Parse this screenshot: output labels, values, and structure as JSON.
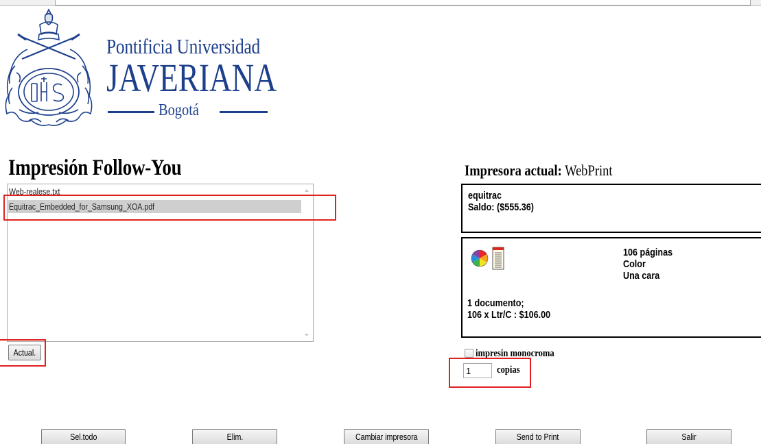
{
  "logo": {
    "line1": "Pontificia Universidad",
    "line2": "JAVERIANA",
    "city": "Bogotá",
    "color": "#1d3f8c"
  },
  "page_title": "Impresión Follow-You",
  "files": [
    {
      "name": "Web-realese.txt",
      "selected": false
    },
    {
      "name": "Equitrac_Embedded_for_Samsung_XOA.pdf",
      "selected": true
    }
  ],
  "actual_button": "Actual.",
  "printer": {
    "label": "Impresora actual:",
    "name": "WebPrint"
  },
  "account": {
    "user": "equitrac",
    "balance": "Saldo: ($555.36)"
  },
  "job": {
    "icons": [
      "color-wheel-icon",
      "document-icon"
    ],
    "pages": "106 páginas",
    "color_mode": "Color",
    "sides": "Una cara",
    "documents": "1 documento;",
    "cost": "106 x Ltr/C : $106.00"
  },
  "monochrome": {
    "label": "impresin monocroma",
    "checked": false
  },
  "copies": {
    "value": "1",
    "label": "copias"
  },
  "buttons": {
    "select_all": "Sel.todo",
    "delete": "Elim.",
    "change_printer": "Cambiar impresora",
    "send": "Send to Print",
    "exit": "Salir"
  },
  "colors": {
    "highlight": "#e0201e",
    "selection": "#cfcfcf"
  }
}
